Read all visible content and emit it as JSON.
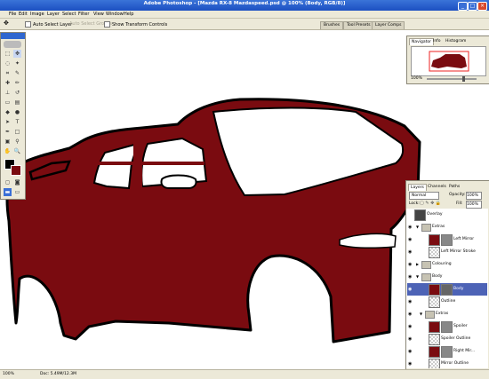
{
  "window": {
    "title": "Adobe Photoshop - [Mazda RX-8 Mazdaspeed.psd @ 100% (Body, RGB/8)]"
  },
  "menu": [
    "File",
    "Edit",
    "Image",
    "Layer",
    "Select",
    "Filter",
    "View",
    "Window",
    "Help"
  ],
  "options": {
    "auto_select": "Auto Select Layer",
    "auto_select_groups": "Auto Select Groups",
    "transform": "Show Transform Controls"
  },
  "dock_tabs": [
    "Brushes",
    "Tool Presets",
    "Layer Comps"
  ],
  "navigator": {
    "tabs": [
      "Navigator",
      "Info",
      "Histogram"
    ],
    "zoom": "100%"
  },
  "layers_panel": {
    "tabs": [
      "Layers",
      "Channels",
      "Paths"
    ],
    "blend_mode": "Normal",
    "opacity_label": "Opacity:",
    "opacity": "100%",
    "lock_label": "Lock:",
    "fill_label": "Fill:",
    "fill": "100%",
    "rows": [
      {
        "name": "Overlay",
        "type": "layer"
      },
      {
        "name": "Extras",
        "type": "group"
      },
      {
        "name": "Left Mirror",
        "type": "layer"
      },
      {
        "name": "Left Mirror Stroke",
        "type": "layer"
      },
      {
        "name": "Colouring",
        "type": "group"
      },
      {
        "name": "Body",
        "type": "group"
      },
      {
        "name": "Body",
        "type": "layer"
      },
      {
        "name": "Outline",
        "type": "layer"
      },
      {
        "name": "Extras",
        "type": "group"
      },
      {
        "name": "Spoiler",
        "type": "layer"
      },
      {
        "name": "Spoiler Outline",
        "type": "layer"
      },
      {
        "name": "Right Mir...",
        "type": "layer"
      },
      {
        "name": "Mirror Outline",
        "type": "layer"
      }
    ]
  },
  "status": {
    "zoom": "100%",
    "doc": "Doc: 5.49M/12.3M"
  },
  "colors": {
    "body": "#7a0b10",
    "titlebar": "#2f66cf",
    "selection": "#4d63b6"
  }
}
